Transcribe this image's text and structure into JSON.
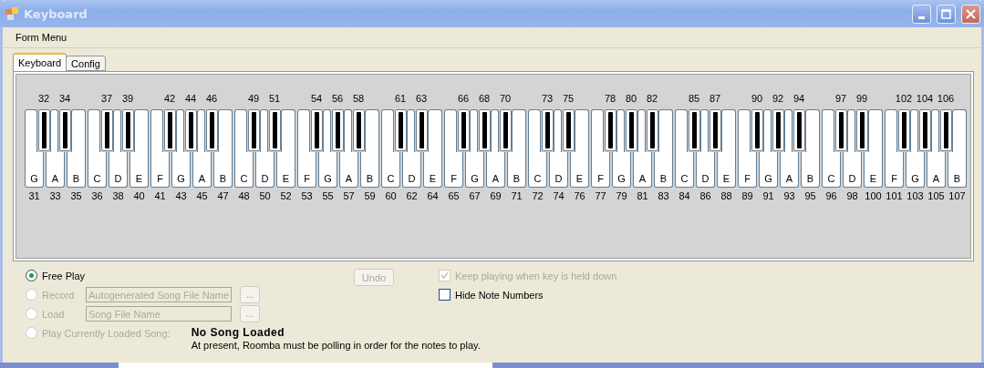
{
  "window": {
    "title": "Keyboard",
    "active": false
  },
  "menu": [
    "Form Menu"
  ],
  "tabs": [
    {
      "label": "Keyboard",
      "selected": true
    },
    {
      "label": "Config",
      "selected": false
    }
  ],
  "white_keys": [
    {
      "note": "G",
      "number": "31",
      "black_key": {
        "number": "32"
      }
    },
    {
      "note": "A",
      "number": "33",
      "black_key": {
        "number": "34"
      }
    },
    {
      "note": "B",
      "number": "35"
    },
    {
      "note": "C",
      "number": "36",
      "black_key": {
        "number": "37"
      }
    },
    {
      "note": "D",
      "number": "38",
      "black_key": {
        "number": "39"
      }
    },
    {
      "note": "E",
      "number": "40"
    },
    {
      "note": "F",
      "number": "41",
      "black_key": {
        "number": "42"
      }
    },
    {
      "note": "G",
      "number": "43",
      "black_key": {
        "number": "44"
      }
    },
    {
      "note": "A",
      "number": "45",
      "black_key": {
        "number": "46"
      }
    },
    {
      "note": "B",
      "number": "47"
    },
    {
      "note": "C",
      "number": "48",
      "black_key": {
        "number": "49"
      }
    },
    {
      "note": "D",
      "number": "50",
      "black_key": {
        "number": "51"
      }
    },
    {
      "note": "E",
      "number": "52"
    },
    {
      "note": "F",
      "number": "53",
      "black_key": {
        "number": "54"
      }
    },
    {
      "note": "G",
      "number": "55",
      "black_key": {
        "number": "56"
      }
    },
    {
      "note": "A",
      "number": "57",
      "black_key": {
        "number": "58"
      }
    },
    {
      "note": "B",
      "number": "59"
    },
    {
      "note": "C",
      "number": "60",
      "black_key": {
        "number": "61"
      }
    },
    {
      "note": "D",
      "number": "62",
      "black_key": {
        "number": "63"
      }
    },
    {
      "note": "E",
      "number": "64"
    },
    {
      "note": "F",
      "number": "65",
      "black_key": {
        "number": "66"
      }
    },
    {
      "note": "G",
      "number": "67",
      "black_key": {
        "number": "68"
      }
    },
    {
      "note": "A",
      "number": "69",
      "black_key": {
        "number": "70"
      }
    },
    {
      "note": "B",
      "number": "71"
    },
    {
      "note": "C",
      "number": "72",
      "black_key": {
        "number": "73"
      }
    },
    {
      "note": "D",
      "number": "74",
      "black_key": {
        "number": "75"
      }
    },
    {
      "note": "E",
      "number": "76"
    },
    {
      "note": "F",
      "number": "77",
      "black_key": {
        "number": "78"
      }
    },
    {
      "note": "G",
      "number": "79",
      "black_key": {
        "number": "80"
      }
    },
    {
      "note": "A",
      "number": "81",
      "black_key": {
        "number": "82"
      }
    },
    {
      "note": "B",
      "number": "83"
    },
    {
      "note": "C",
      "number": "84",
      "black_key": {
        "number": "85"
      }
    },
    {
      "note": "D",
      "number": "86",
      "black_key": {
        "number": "87"
      }
    },
    {
      "note": "E",
      "number": "88"
    },
    {
      "note": "F",
      "number": "89",
      "black_key": {
        "number": "90"
      }
    },
    {
      "note": "G",
      "number": "91",
      "black_key": {
        "number": "92"
      }
    },
    {
      "note": "A",
      "number": "93",
      "black_key": {
        "number": "94"
      }
    },
    {
      "note": "B",
      "number": "95"
    },
    {
      "note": "C",
      "number": "96",
      "black_key": {
        "number": "97"
      }
    },
    {
      "note": "D",
      "number": "98",
      "black_key": {
        "number": "99"
      }
    },
    {
      "note": "E",
      "number": "100"
    },
    {
      "note": "F",
      "number": "101",
      "black_key": {
        "number": "102"
      }
    },
    {
      "note": "G",
      "number": "103",
      "black_key": {
        "number": "104"
      }
    },
    {
      "note": "A",
      "number": "105",
      "black_key": {
        "number": "106"
      }
    },
    {
      "note": "B",
      "number": "107"
    }
  ],
  "modes": [
    {
      "label": "Free Play",
      "selected": true,
      "disabled": false
    },
    {
      "label": "Record",
      "selected": false,
      "disabled": true,
      "field": {
        "value": "Autogenerated Song File Name"
      },
      "browse": "..."
    },
    {
      "label": "Load",
      "selected": false,
      "disabled": true,
      "field": {
        "value": "Song File Name"
      },
      "browse": "..."
    },
    {
      "label": "Play Currently Loaded Song:",
      "selected": false,
      "disabled": true
    }
  ],
  "undo": {
    "label": "Undo",
    "disabled": true
  },
  "options": [
    {
      "label": "Keep playing when key is held down",
      "checked": true,
      "disabled": true
    },
    {
      "label": "Hide Note Numbers",
      "checked": false,
      "disabled": false
    }
  ],
  "song_status": "No Song Loaded",
  "note": "At present, Roomba must be polling in order for the notes to play."
}
